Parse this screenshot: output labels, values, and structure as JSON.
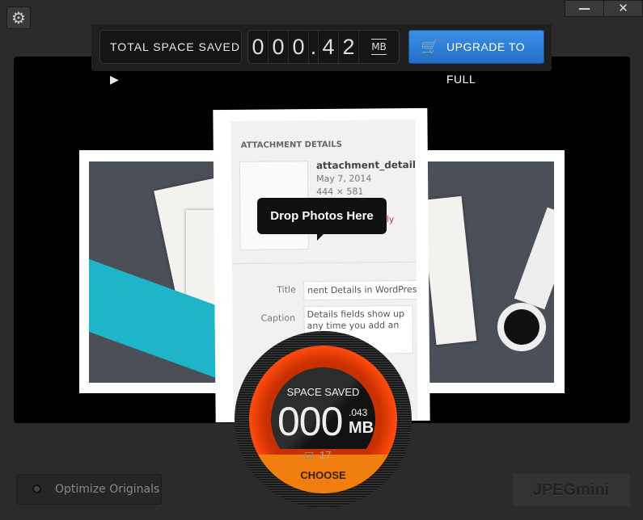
{
  "window": {
    "settings_icon": "gear-icon",
    "minimize_label": "—",
    "close_label": "✕"
  },
  "header": {
    "total_space_saved_label": "TOTAL SPACE SAVED ▶",
    "counter_digits": [
      "0",
      "0",
      "0",
      ".",
      "4",
      "2"
    ],
    "counter_unit": "MB",
    "upgrade_label": "UPGRADE TO FULL",
    "upgrade_icon": "cart-icon",
    "accent_color": "#2f7fd8"
  },
  "dropzone": {
    "tooltip": "Drop Photos Here",
    "photo": {
      "heading": "ATTACHMENT DETAILS",
      "filename": "attachment_details.png",
      "date": "May 7, 2014",
      "dimensions": "444 × 581",
      "delete_fragment": "tly",
      "title_label": "Title",
      "title_value": "nent Details in WordPress",
      "caption_label": "Caption",
      "caption_value": "Details fields show up any time you add an ... post or"
    }
  },
  "dial": {
    "label": "SPACE SAVED",
    "value_main": "000",
    "value_fraction": ".043",
    "unit": "MB",
    "photo_count": "17",
    "choose_label": "CHOOSE",
    "ring_color": "#e83c0a",
    "choose_color": "#f07f10"
  },
  "footer": {
    "optimize_label": "Optimize Originals",
    "optimize_checked": false,
    "logo": "JPEGmini"
  }
}
